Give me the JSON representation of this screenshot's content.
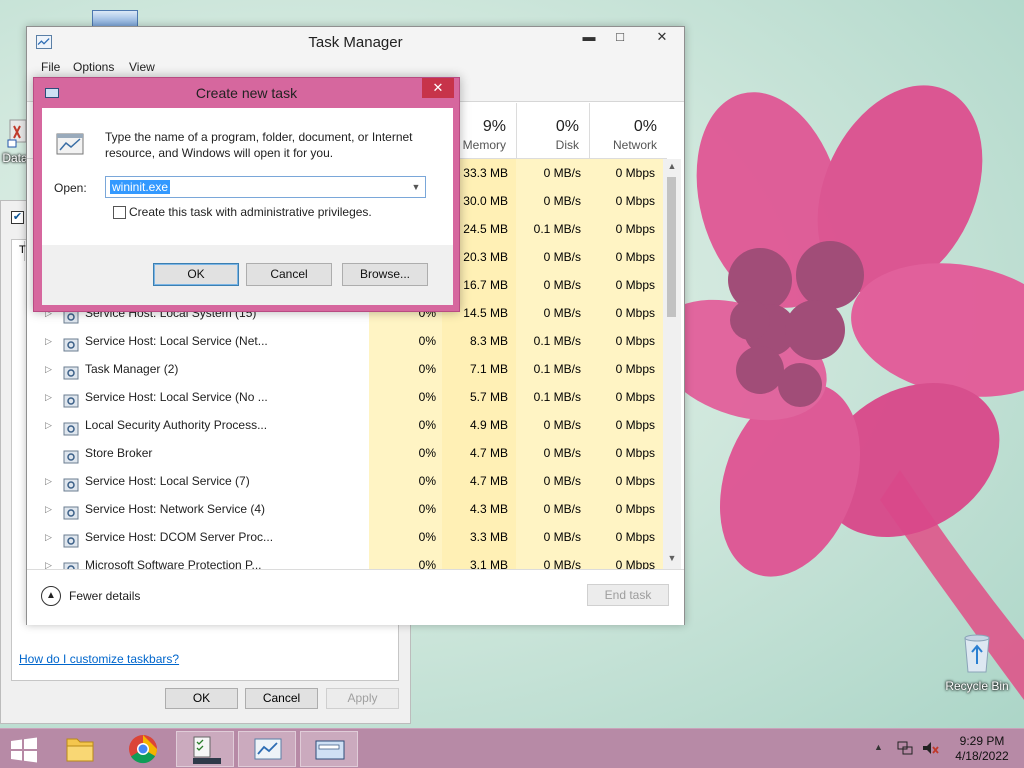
{
  "desktop": {
    "recycle_bin_label": "Recycle Bin",
    "data_icon_label": "Data"
  },
  "properties_window": {
    "tab_label": "T",
    "help_link": "How do I customize taskbars?",
    "ok_label": "OK",
    "cancel_label": "Cancel",
    "apply_label": "Apply"
  },
  "task_manager": {
    "title": "Task Manager",
    "menu": {
      "file": "File",
      "options": "Options",
      "view": "View"
    },
    "caption": {
      "minimize": "▬",
      "maximize": "□",
      "close": "✕"
    },
    "columns": {
      "memory": {
        "pct": "9%",
        "label": "Memory"
      },
      "disk": {
        "pct": "0%",
        "label": "Disk"
      },
      "network": {
        "pct": "0%",
        "label": "Network"
      }
    },
    "rows": [
      {
        "name": "",
        "cpu": "",
        "mem": "33.3 MB",
        "disk": "0 MB/s",
        "net": "0 Mbps",
        "expand": false
      },
      {
        "name": "",
        "cpu": "",
        "mem": "30.0 MB",
        "disk": "0 MB/s",
        "net": "0 Mbps",
        "expand": false
      },
      {
        "name": "",
        "cpu": "",
        "mem": "24.5 MB",
        "disk": "0.1 MB/s",
        "net": "0 Mbps",
        "expand": false
      },
      {
        "name": "",
        "cpu": "",
        "mem": "20.3 MB",
        "disk": "0 MB/s",
        "net": "0 Mbps",
        "expand": false
      },
      {
        "name": "",
        "cpu": "",
        "mem": "16.7 MB",
        "disk": "0 MB/s",
        "net": "0 Mbps",
        "expand": false
      },
      {
        "name": "Service Host: Local System (15)",
        "cpu": "0%",
        "mem": "14.5 MB",
        "disk": "0 MB/s",
        "net": "0 Mbps",
        "expand": true
      },
      {
        "name": "Service Host: Local Service (Net...",
        "cpu": "0%",
        "mem": "8.3 MB",
        "disk": "0.1 MB/s",
        "net": "0 Mbps",
        "expand": true
      },
      {
        "name": "Task Manager (2)",
        "cpu": "0%",
        "mem": "7.1 MB",
        "disk": "0.1 MB/s",
        "net": "0 Mbps",
        "expand": true
      },
      {
        "name": "Service Host: Local Service (No ...",
        "cpu": "0%",
        "mem": "5.7 MB",
        "disk": "0.1 MB/s",
        "net": "0 Mbps",
        "expand": true
      },
      {
        "name": "Local Security Authority Process...",
        "cpu": "0%",
        "mem": "4.9 MB",
        "disk": "0 MB/s",
        "net": "0 Mbps",
        "expand": true
      },
      {
        "name": "Store Broker",
        "cpu": "0%",
        "mem": "4.7 MB",
        "disk": "0 MB/s",
        "net": "0 Mbps",
        "expand": false
      },
      {
        "name": "Service Host: Local Service (7)",
        "cpu": "0%",
        "mem": "4.7 MB",
        "disk": "0 MB/s",
        "net": "0 Mbps",
        "expand": true
      },
      {
        "name": "Service Host: Network Service (4)",
        "cpu": "0%",
        "mem": "4.3 MB",
        "disk": "0 MB/s",
        "net": "0 Mbps",
        "expand": true
      },
      {
        "name": "Service Host: DCOM Server Proc...",
        "cpu": "0%",
        "mem": "3.3 MB",
        "disk": "0 MB/s",
        "net": "0 Mbps",
        "expand": true
      },
      {
        "name": "Microsoft Software Protection P...",
        "cpu": "0%",
        "mem": "3.1 MB",
        "disk": "0 MB/s",
        "net": "0 Mbps",
        "expand": true
      }
    ],
    "fewer_details": "Fewer details",
    "end_task": "End task"
  },
  "run_dialog": {
    "title": "Create new task",
    "close": "✕",
    "description": "Type the name of a program, folder, document, or Internet resource, and Windows will open it for you.",
    "open_label": "Open:",
    "open_value": "wininit.exe",
    "admin_label": "Create this task with administrative privileges.",
    "ok_label": "OK",
    "cancel_label": "Cancel",
    "browse_label": "Browse..."
  },
  "taskbar": {
    "time": "9:29 PM",
    "date": "4/18/2022",
    "tray_arrow": "▲"
  },
  "icons": {
    "start": "windows-logo-icon",
    "explorer": "folder-icon",
    "chrome": "chrome-icon",
    "control": "control-panel-icon",
    "taskmgr": "task-manager-icon",
    "run": "run-dialog-icon"
  },
  "colors": {
    "dialog_frame": "#d6679e",
    "close_button": "#c7334a",
    "taskbar": "#b78aa6",
    "cpu_mem_highlight": "#fff0b5",
    "selection": "#3399ff"
  }
}
